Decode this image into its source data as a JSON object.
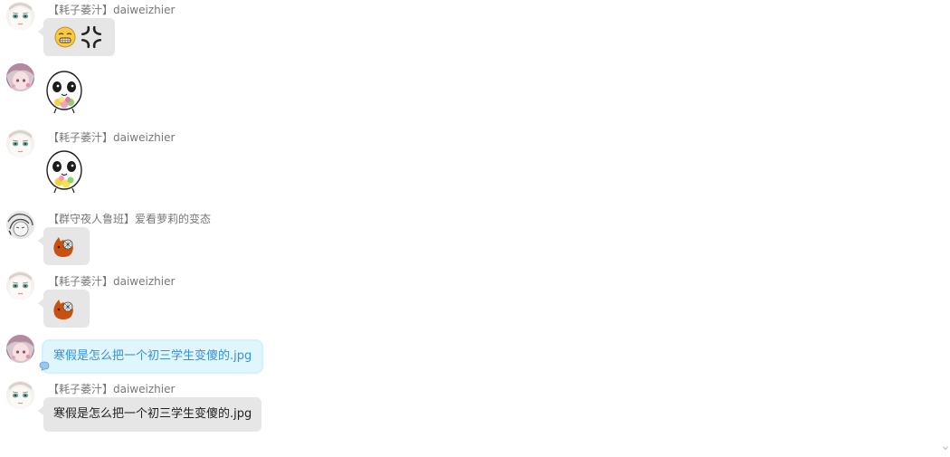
{
  "colors": {
    "bubble": "#e6e6e6",
    "bubble_blue": "#dff6fd",
    "bubble_blue_text": "#3a8fd6",
    "sender_text": "#777777",
    "sticker_orange": "#c8510f"
  },
  "messages": [
    {
      "sender": "【耗子萎汁】daiweizhier",
      "type": "emoji",
      "icons": [
        "grimace-emoji-icon",
        "anger-symbol-icon"
      ],
      "avatar": "pale-face-avatar"
    },
    {
      "sender": "",
      "type": "sticker",
      "icon": "panda-face-flower-sticker",
      "avatar": "pink-hair-avatar"
    },
    {
      "sender": "【耗子萎汁】daiweizhier",
      "type": "sticker",
      "icon": "panda-face-flower-sticker",
      "avatar": "pale-face-avatar"
    },
    {
      "sender": "【群守夜人鲁班】爱看萝莉的变态",
      "type": "emoji",
      "icon": "orange-creature-emoji-icon",
      "avatar": "sketch-avatar"
    },
    {
      "sender": "【耗子萎汁】daiweizhier",
      "type": "emoji",
      "icon": "orange-creature-emoji-icon",
      "avatar": "pale-face-avatar"
    },
    {
      "sender": "",
      "type": "text",
      "text": "寒假是怎么把一个初三学生变傻的.jpg",
      "style": "blue",
      "avatar": "pink-hair-avatar"
    },
    {
      "sender": "【耗子萎汁】daiweizhier",
      "type": "text",
      "text": "寒假是怎么把一个初三学生变傻的.jpg",
      "style": "gray",
      "avatar": "pale-face-avatar"
    }
  ]
}
